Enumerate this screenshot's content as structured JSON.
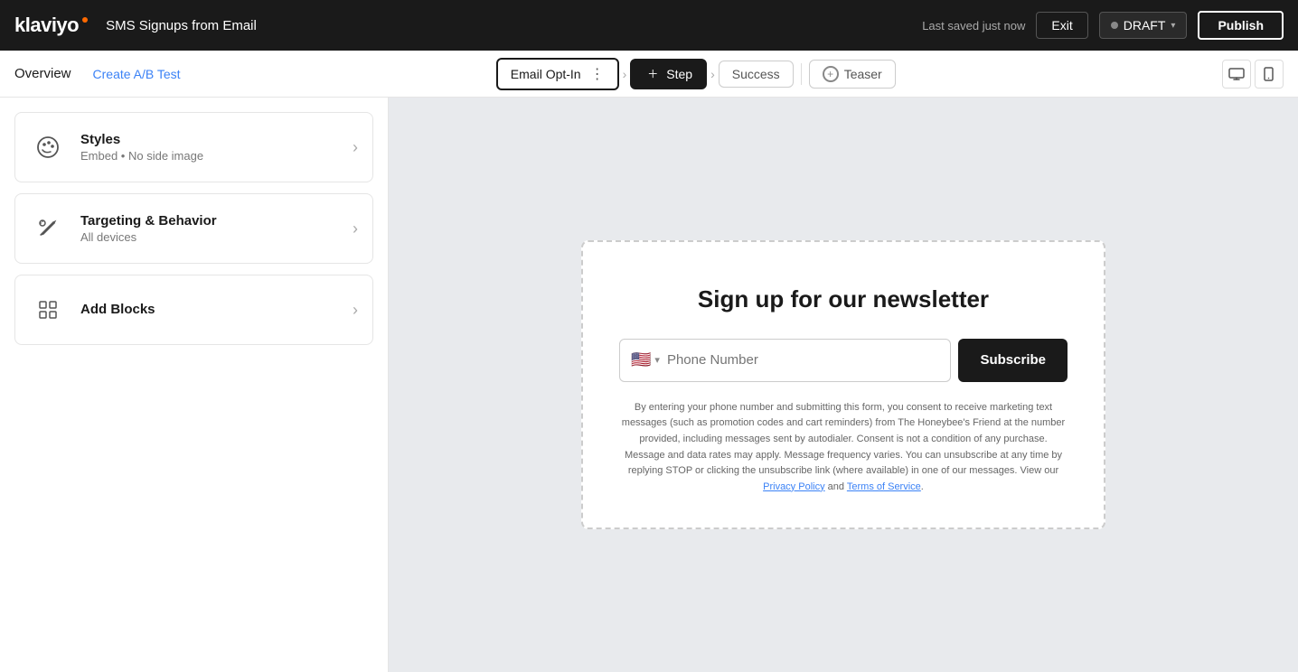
{
  "topnav": {
    "logo_text": "klaviyo",
    "page_title": "SMS Signups from Email",
    "last_saved": "Last saved just now",
    "exit_label": "Exit",
    "draft_label": "DRAFT",
    "publish_label": "Publish"
  },
  "secondnav": {
    "overview_label": "Overview",
    "create_ab_label": "Create A/B Test",
    "steps": [
      {
        "label": "Email Opt-In",
        "type": "outline",
        "has_options": true
      },
      {
        "label": "Step",
        "type": "filled"
      },
      {
        "label": "Success",
        "type": "inactive"
      },
      {
        "label": "Teaser",
        "type": "inactive_plus"
      }
    ]
  },
  "sidebar": {
    "cards": [
      {
        "id": "styles",
        "title": "Styles",
        "subtitle": "Embed • No side image",
        "icon": "🎨"
      },
      {
        "id": "targeting",
        "title": "Targeting & Behavior",
        "subtitle": "All devices",
        "icon": "✏️"
      },
      {
        "id": "blocks",
        "title": "Add Blocks",
        "subtitle": "",
        "icon": "▦"
      }
    ]
  },
  "preview": {
    "form_title": "Sign up for our newsletter",
    "phone_placeholder": "Phone Number",
    "subscribe_label": "Subscribe",
    "disclaimer": "By entering your phone number and submitting this form, you consent to receive marketing text messages (such as promotion codes and cart reminders) from The Honeybee's Friend at the number provided, including messages sent by autodialer. Consent is not a condition of any purchase. Message and data rates may apply. Message frequency varies. You can unsubscribe at any time by replying STOP or clicking the unsubscribe link (where available) in one of our messages. View our ",
    "privacy_policy_label": "Privacy Policy",
    "and_label": " and ",
    "terms_label": "Terms of Service",
    "disclaimer_end": "."
  }
}
